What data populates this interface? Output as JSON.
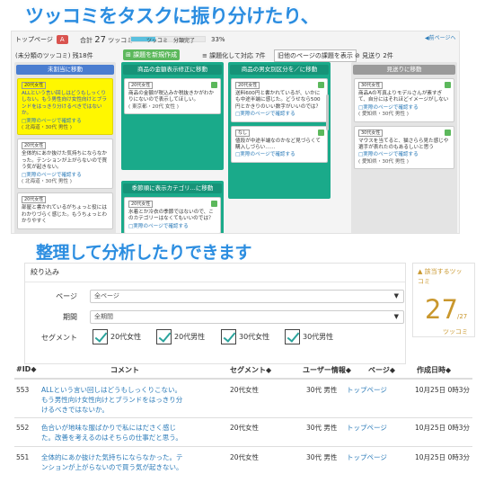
{
  "headline1": "ツッコミをタスクに振り分けたり、",
  "headline2": "整理して分析したりできます",
  "board": {
    "toppage_label": "トップページ",
    "toppage_badge": "A",
    "total_label": "合計",
    "total_value": "27",
    "total_unit": "ツッコミ",
    "prog_label": "ツッコミ　分類完了",
    "prog_percent": "33%",
    "prog_value": 0.33,
    "back_link": "◀前ページへ",
    "unassigned": "(未分類のツッコミ) 残18件",
    "create_task": "⊞ 課題を新規作成",
    "resolved": "≡ 課題化して対応 7件",
    "past_pages": "旧他のページの課題を表示",
    "overlook": "⊘ 見送り 2件",
    "columns": [
      {
        "button": "未割当に移動",
        "cards": [
          {
            "tag": "20代女性",
            "text": "ALLという言い回しはどうもしっくりしない。もう男性向け女性向けとブランドをはっきり分けるべきではないか。",
            "link": "□実際のページで確認する",
            "meta": "( 北海道・30代 男性 )",
            "yellow": true
          },
          {
            "tag": "20代女性",
            "text": "全体的にあか抜けた気持ちにならなかった。テンションが上がらないので買う気が起きない。",
            "link": "□実際のページで確認する",
            "meta": "( 北海道・30代 男性 )"
          },
          {
            "tag": "20代女性",
            "text": "部屋と書かれているがちょっと役にはわかりづらく感じた。もうちょっとわかりやすく",
            "link": "",
            "meta": ""
          }
        ]
      },
      {
        "button": "商品の金額表示修正に移動",
        "cards": [
          {
            "tag": "20代女性",
            "text": "商品の金額が税込みか税抜きかがわかりにないので表示してほしい。",
            "link": "",
            "meta": "( 東京都・20代 女性 )"
          }
        ]
      },
      {
        "button": "商品の男女別区分を／に移動",
        "cards": [
          {
            "tag": "20代女性",
            "text": "送料600円と書かれているが、いかにも中途半端に感じた。どうせなら500円とかきりのいい数字がいいのでは？",
            "link": "□実際のページで確認する",
            "meta": ""
          },
          {
            "tag": "なし",
            "text": "値段が中途半端なのかなど見づらくて購入しづらい……",
            "link": "□実際のページで確認する",
            "meta": ""
          }
        ]
      },
      {
        "button": "見送りに移動",
        "cards": [
          {
            "tag": "30代女性",
            "text": "商品Aの写真よりモデルさんが素すぎて、自分にはそれほどイメージがしない",
            "link": "□実際のページで確認する",
            "meta": "( 愛知県・30代 男性 )"
          },
          {
            "tag": "30代女性",
            "text": "マウスを当てると、猫さらら見た感じや選手が表れたのもあるしいと思う",
            "link": "□実際のページで確認する",
            "meta": "( 愛知県・30代 男性 )"
          }
        ]
      }
    ],
    "extra_column": {
      "button": "季節順に表示カテゴリ...に移動",
      "cards": [
        {
          "tag": "20代女性",
          "text": "水着とか冷衣の季節ではないので、このカテゴリーはなくてもいいのでは？",
          "link": "□実際のページで確認する",
          "meta": ""
        }
      ]
    }
  },
  "filter": {
    "title": "絞り込み",
    "page_label": "ページ",
    "page_value": "全ページ",
    "period_label": "期間",
    "period_value": "全期間",
    "segment_label": "セグメント",
    "segments": [
      "20代女性",
      "20代男性",
      "30代女性",
      "30代男性"
    ]
  },
  "count": {
    "label1": "▲ 該当するツッ",
    "label2": "コミ",
    "value": "27",
    "denominator": "/27",
    "unit": "ツッコミ"
  },
  "table": {
    "headers": [
      "#ID◆",
      "コメント",
      "セグメント◆",
      "ユーザー情報◆",
      "ページ◆",
      "作成日時◆"
    ],
    "rows": [
      {
        "id": "553",
        "comment": "ALLという言い回しはどうもしっくりこない。もう男性向け女性向けとブランドをはっきり分けるべきではないか。",
        "segment": "20代女性",
        "user": "30代 男性",
        "page": "トップページ",
        "date": "10月25日 0時3分"
      },
      {
        "id": "552",
        "comment": "色合いが地味な服ばかりで私にはださく感じた。改善を考えるのはそちらの仕事だと思う。",
        "segment": "20代女性",
        "user": "30代 男性",
        "page": "トップページ",
        "date": "10月25日 0時3分"
      },
      {
        "id": "551",
        "comment": "全体的にあか抜けた気持ちにならなかった。テンションが上がらないので買う気が起きない。",
        "segment": "20代女性",
        "user": "30代 男性",
        "page": "トップページ",
        "date": "10月25日 0時3分"
      }
    ]
  },
  "colors": {
    "accent": "#2b8de0",
    "teal": "#1aaa8a",
    "gold": "#c9972d",
    "link": "#2a7ab8"
  }
}
